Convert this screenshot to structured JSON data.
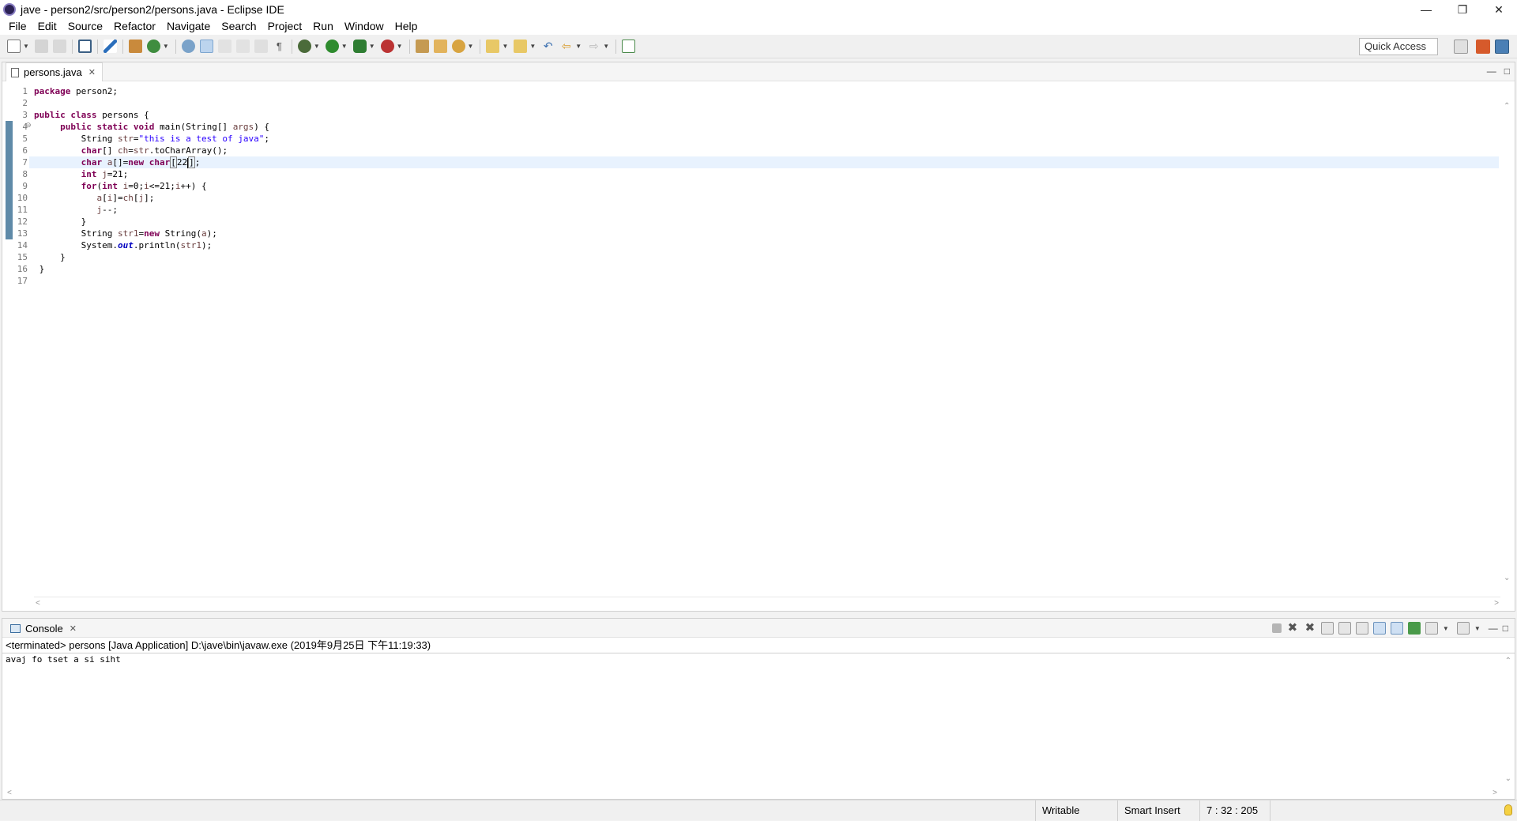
{
  "window": {
    "title": "jave - person2/src/person2/persons.java - Eclipse IDE",
    "controls": [
      "minimize",
      "restore",
      "close"
    ]
  },
  "menu": [
    "File",
    "Edit",
    "Source",
    "Refactor",
    "Navigate",
    "Search",
    "Project",
    "Run",
    "Window",
    "Help"
  ],
  "toolbar": {
    "quick_access": "Quick Access",
    "icons": [
      "new-icon",
      "save-icon",
      "save-all-icon",
      "terminal-icon",
      "skip-breakpoints-icon",
      "new-java-project-icon",
      "new-class-icon",
      "search-icon",
      "mark-occurrences-icon",
      "next-annotation-icon",
      "word-wrap-icon",
      "block-select-icon",
      "show-whitespace-icon",
      "debug-icon",
      "run-icon",
      "coverage-icon",
      "external-tools-icon",
      "open-type-icon",
      "open-task-icon",
      "search-dropdown-icon",
      "next-annotation-down-icon",
      "previous-annotation-icon",
      "back-icon",
      "forward-icon",
      "pin-editor-icon"
    ]
  },
  "editor": {
    "tab": {
      "label": "persons.java"
    },
    "line_numbers": [
      "1",
      "2",
      "3",
      "4",
      "5",
      "6",
      "7",
      "8",
      "9",
      "10",
      "11",
      "12",
      "13",
      "14",
      "15",
      "16",
      "17"
    ],
    "current_line": 7
  },
  "console": {
    "tab": {
      "label": "Console"
    },
    "status": "<terminated> persons [Java Application] D:\\jave\\bin\\javaw.exe (2019年9月25日 下午11:19:33)",
    "output": "avaj fo tset a si siht"
  },
  "statusbar": {
    "writable": "Writable",
    "insert_mode": "Smart Insert",
    "position": "7 : 32 : 205"
  },
  "colors": {
    "keyword": "#7f0055",
    "string": "#2a00ff",
    "variable": "#6a3e3e",
    "current_line": "#e8f2fe",
    "change_bar": "#5f8aa8"
  }
}
